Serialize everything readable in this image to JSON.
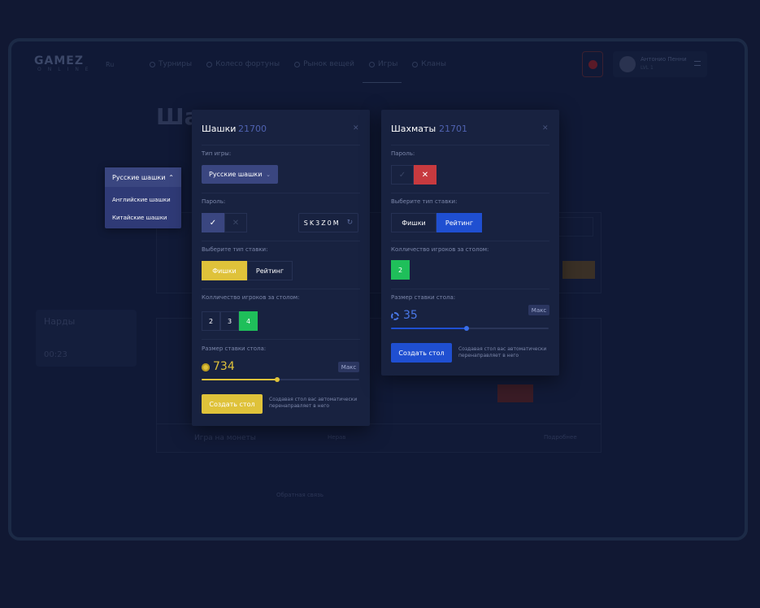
{
  "background": {
    "logo": "GAMEZ",
    "logo_sub": "ONLINE",
    "lang": "Ru",
    "nav": [
      "Турниры",
      "Колесо фортуны",
      "Рынок вещей",
      "Игры",
      "Кланы"
    ],
    "user_name": "Антонио Пенни",
    "user_meta": "LVL 1",
    "page_title": "Ша",
    "card_title": "Нарды",
    "card_time": "00:23",
    "row_text": "Игра на монеты",
    "row_badge": "Нерав",
    "row_btn": "Подробнее",
    "footer_link": "Обратная связь"
  },
  "dropdown": {
    "selected": "Русские шашки",
    "options": [
      "Английские шашки",
      "Китайские шашки"
    ]
  },
  "modal_checkers": {
    "title": "Шашки",
    "id": "21700",
    "game_type_label": "Тип игры:",
    "game_type_value": "Русские шашки",
    "password_label": "Пароль:",
    "password_code": "SK3Z0M",
    "bet_type_label": "Выберите тип ставки:",
    "bet_types": [
      "Фишки",
      "Рейтинг"
    ],
    "players_label": "Колличество игроков за столом:",
    "players_options": [
      "2",
      "3",
      "4"
    ],
    "players_selected": "4",
    "bet_size_label": "Размер ставки стола:",
    "bet_value": "734",
    "max_label": "Макс",
    "slider_fraction": 0.48,
    "create_button": "Создать стол",
    "hint": "Создавая стол вас автоматически перенаправляет в него"
  },
  "modal_chess": {
    "title": "Шахматы",
    "id": "21701",
    "password_label": "Пароль:",
    "bet_type_label": "Выберите тип ставки:",
    "bet_types": [
      "Фишки",
      "Рейтинг"
    ],
    "players_label": "Колличество игроков за столом:",
    "players_value": "2",
    "bet_size_label": "Размер ставки стола:",
    "bet_value": "35",
    "max_label": "Макс",
    "slider_fraction": 0.48,
    "create_button": "Создать стол",
    "hint": "Создавая стол вас автоматически перенаправляет в него"
  },
  "colors": {
    "accent_yellow": "#dfc23a",
    "accent_blue": "#1f4fd1",
    "accent_green": "#1fbf5a",
    "accent_red": "#c73a3f",
    "panel": "#182240"
  }
}
